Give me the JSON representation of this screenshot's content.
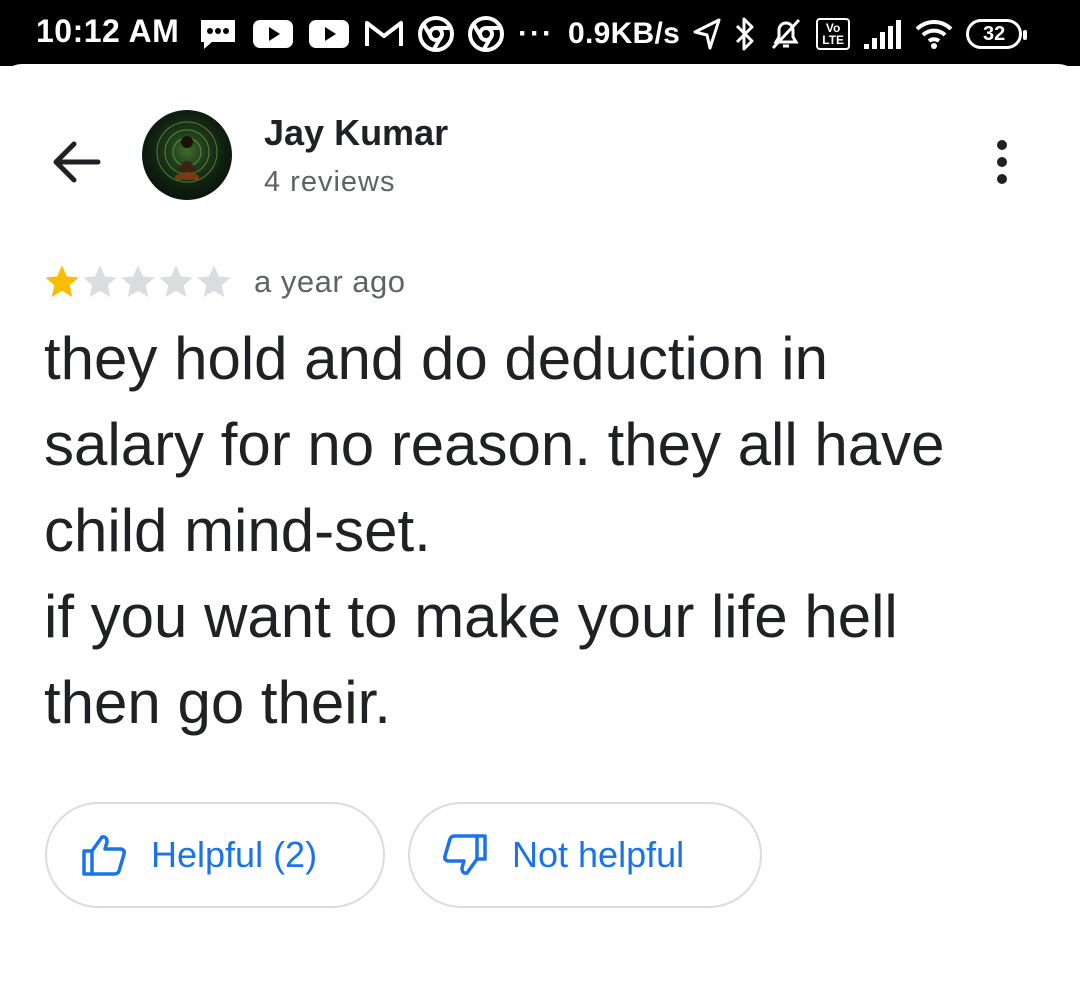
{
  "status_bar": {
    "time": "10:12 AM",
    "network_speed": "0.9KB/s",
    "overflow": "···",
    "battery_level": "32",
    "volte_label": "Vo LTE",
    "icons": [
      "messages-icon",
      "youtube-icon",
      "youtube-icon",
      "gmail-icon",
      "chrome-icon",
      "chrome-icon",
      "location-icon",
      "bluetooth-icon",
      "muted-alarm-icon",
      "volte-icon",
      "signal-icon",
      "wifi-icon",
      "battery-icon"
    ]
  },
  "review": {
    "author_name": "Jay Kumar",
    "author_review_count": "4 reviews",
    "rating": 1,
    "max_rating": 5,
    "time_ago": "a year ago",
    "text_lines": [
      "they hold and do deduction in",
      "salary for no reason. they all have",
      "child mind-set.",
      "if you want to make your life hell",
      "then go their."
    ]
  },
  "actions": {
    "helpful_label": "Helpful (2)",
    "not_helpful_label": "Not helpful"
  },
  "colors": {
    "accent": "#1a73e8",
    "star_filled": "#fbbc04",
    "star_empty": "#dadce0",
    "text_primary": "#202124",
    "text_secondary": "#5f6368",
    "status_bar": "#000000"
  }
}
